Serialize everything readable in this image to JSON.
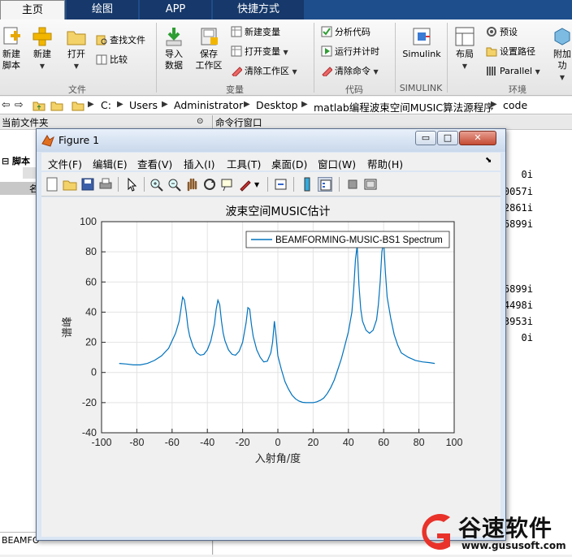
{
  "tabs": [
    {
      "label": "主页",
      "active": true
    },
    {
      "label": "绘图",
      "active": false
    },
    {
      "label": "APP",
      "active": false
    },
    {
      "label": "快捷方式",
      "active": false
    }
  ],
  "ribbon": {
    "file": {
      "new_script": "新建\n脚本",
      "new": "新建",
      "open": "打开",
      "find_files": "查找文件",
      "compare": "比较",
      "group": "文件"
    },
    "variable": {
      "import": "导入\n数据",
      "save": "保存\n工作区",
      "new_var": "新建变量",
      "open_var": "打开变量",
      "clear_ws": "清除工作区",
      "group": "变量"
    },
    "code": {
      "analyze": "分析代码",
      "run_time": "运行并计时",
      "clear_cmd": "清除命令",
      "group": "代码"
    },
    "simulink": {
      "label": "Simulink",
      "group": "SIMULINK"
    },
    "env": {
      "layout": "布局",
      "prefs": "预设",
      "set_path": "设置路径",
      "parallel": "Parallel",
      "addons": "附加功",
      "group": "环境"
    }
  },
  "address": {
    "crumbs": [
      "C:",
      "Users",
      "Administrator",
      "Desktop",
      "matlab编程波束空间MUSIC算法源程序",
      "code"
    ]
  },
  "left_panel": {
    "title": "当前文件夹",
    "item_script": "脚本",
    "item_name": "名",
    "bottom": "BEAMFO"
  },
  "cmd_panel": {
    "title": "命令行窗口",
    "lines": [
      "0i",
      "0057i",
      "2861i",
      "6899i",
      "6899i",
      "4498i",
      "3953i",
      "0i"
    ]
  },
  "figure": {
    "title": "Figure 1",
    "menu": [
      "文件(F)",
      "编辑(E)",
      "查看(V)",
      "插入(I)",
      "工具(T)",
      "桌面(D)",
      "窗口(W)",
      "帮助(H)"
    ]
  },
  "chart_data": {
    "type": "line",
    "title": "波束空间MUSIC估计",
    "xlabel": "入射角/度",
    "ylabel": "谱峰",
    "xlim": [
      -100,
      100
    ],
    "ylim": [
      -40,
      100
    ],
    "xticks": [
      -100,
      -80,
      -60,
      -40,
      -20,
      0,
      20,
      40,
      60,
      80,
      100
    ],
    "yticks": [
      -40,
      -20,
      0,
      20,
      40,
      60,
      80,
      100
    ],
    "grid": true,
    "legend_position": "top-right",
    "series": [
      {
        "name": "BEAMFORMING-MUSIC-BS1 Spectrum",
        "color": "#0072bd",
        "x": [
          -90,
          -86,
          -82,
          -78,
          -74,
          -70,
          -66,
          -62,
          -58,
          -56,
          -55,
          -54,
          -53,
          -52,
          -51,
          -50,
          -48,
          -46,
          -44,
          -42,
          -40,
          -38,
          -36,
          -35,
          -34,
          -33,
          -32,
          -31,
          -30,
          -28,
          -26,
          -24,
          -22,
          -20,
          -18,
          -17,
          -16,
          -15,
          -14,
          -12,
          -10,
          -8,
          -6,
          -4,
          -3,
          -2,
          -1,
          0,
          2,
          4,
          6,
          8,
          10,
          12,
          14,
          16,
          18,
          20,
          22,
          24,
          26,
          28,
          30,
          32,
          34,
          36,
          38,
          40,
          42,
          43,
          44,
          45,
          46,
          47,
          48,
          50,
          52,
          54,
          56,
          57,
          58,
          59,
          60,
          61,
          62,
          64,
          66,
          68,
          70,
          74,
          78,
          82,
          86,
          89
        ],
        "y": [
          6,
          5.6,
          5,
          5,
          6,
          8,
          11,
          16,
          26,
          34,
          42,
          50,
          48,
          40,
          30,
          24,
          17,
          13,
          11.5,
          12,
          15,
          21,
          32,
          42,
          48,
          45,
          34,
          26,
          21,
          15,
          12,
          11.5,
          14,
          20,
          33,
          43,
          42,
          32,
          24,
          15,
          10,
          7,
          7.5,
          13,
          20,
          34,
          24,
          11,
          2,
          -6,
          -11,
          -15,
          -17.5,
          -19,
          -19.8,
          -20,
          -20,
          -20,
          -19.5,
          -18.5,
          -17,
          -14,
          -10,
          -5,
          2,
          9,
          18,
          27,
          40,
          55,
          75,
          84,
          58,
          42,
          34,
          28,
          26,
          28,
          35,
          45,
          60,
          80,
          87,
          66,
          50,
          36,
          25,
          18,
          13,
          10,
          8,
          7,
          6.5,
          6
        ]
      }
    ]
  },
  "watermark": {
    "brand": "谷速软件",
    "url": "www.gususoft.com"
  }
}
